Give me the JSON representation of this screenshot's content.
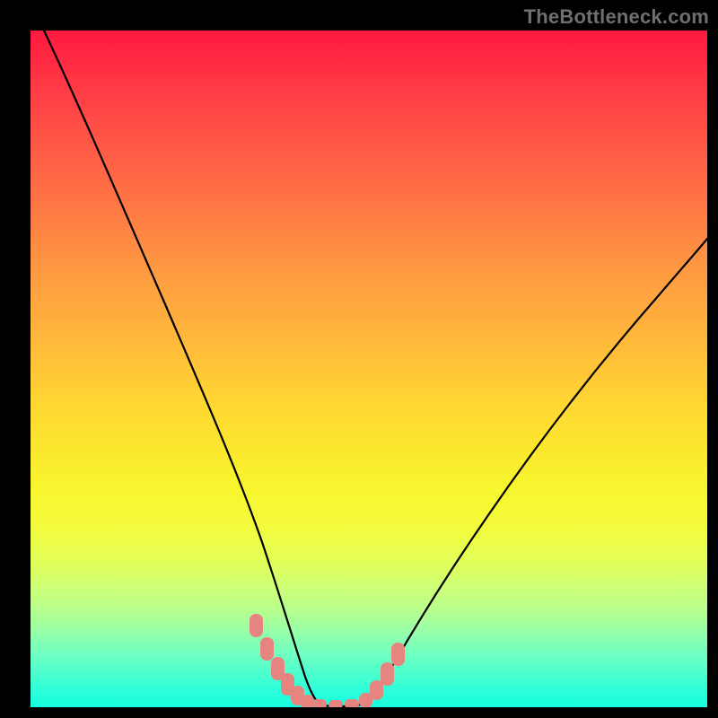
{
  "watermark": "TheBottleneck.com",
  "chart_data": {
    "type": "line",
    "title": "",
    "xlabel": "",
    "ylabel": "",
    "xlim": [
      0,
      100
    ],
    "ylim": [
      0,
      100
    ],
    "background_gradient": {
      "direction": "vertical",
      "stops": [
        {
          "pos": 0,
          "color": "#ff193f"
        },
        {
          "pos": 50,
          "color": "#ffc838"
        },
        {
          "pos": 75,
          "color": "#f4fb3d"
        },
        {
          "pos": 100,
          "color": "#16ffdf"
        }
      ]
    },
    "series": [
      {
        "name": "curve-left",
        "stroke": "#000000",
        "stroke_width": 2,
        "x": [
          2.0,
          4.0,
          6.5,
          9.5,
          13.0,
          17.0,
          21.0,
          25.0,
          28.5,
          31.5,
          33.5,
          35.0,
          36.5,
          38.0,
          39.5,
          41.0
        ],
        "y": [
          100.0,
          93.0,
          85.0,
          76.0,
          66.0,
          55.0,
          44.0,
          33.0,
          23.0,
          15.0,
          10.0,
          7.0,
          5.0,
          3.0,
          1.5,
          0.5
        ]
      },
      {
        "name": "curve-floor",
        "stroke": "#000000",
        "stroke_width": 2,
        "x": [
          41.0,
          42.0,
          43.5,
          45.0,
          46.5,
          48.0
        ],
        "y": [
          0.5,
          0.3,
          0.2,
          0.2,
          0.3,
          0.5
        ]
      },
      {
        "name": "curve-right",
        "stroke": "#000000",
        "stroke_width": 2,
        "x": [
          48.0,
          49.5,
          51.5,
          54.0,
          57.0,
          61.0,
          66.0,
          72.0,
          79.0,
          87.0,
          95.0,
          100.0
        ],
        "y": [
          0.5,
          1.5,
          3.5,
          6.5,
          10.5,
          16.0,
          23.0,
          31.0,
          40.0,
          50.0,
          60.0,
          66.0
        ]
      },
      {
        "name": "markers-left",
        "type": "scatter",
        "marker": "rounded-bar",
        "color": "#e6857f",
        "x": [
          33.0,
          34.5,
          36.0,
          37.5,
          39.0,
          40.5
        ],
        "y": [
          11.0,
          8.0,
          5.5,
          3.5,
          2.0,
          0.8
        ]
      },
      {
        "name": "markers-floor",
        "type": "scatter",
        "marker": "rounded-bar",
        "color": "#e6857f",
        "x": [
          42.0,
          43.5,
          45.0,
          46.5
        ],
        "y": [
          0.3,
          0.2,
          0.2,
          0.3
        ]
      },
      {
        "name": "markers-right",
        "type": "scatter",
        "marker": "rounded-bar",
        "color": "#e6857f",
        "x": [
          48.5,
          50.0,
          51.5,
          53.0
        ],
        "y": [
          1.0,
          2.5,
          4.5,
          7.0
        ]
      }
    ]
  }
}
